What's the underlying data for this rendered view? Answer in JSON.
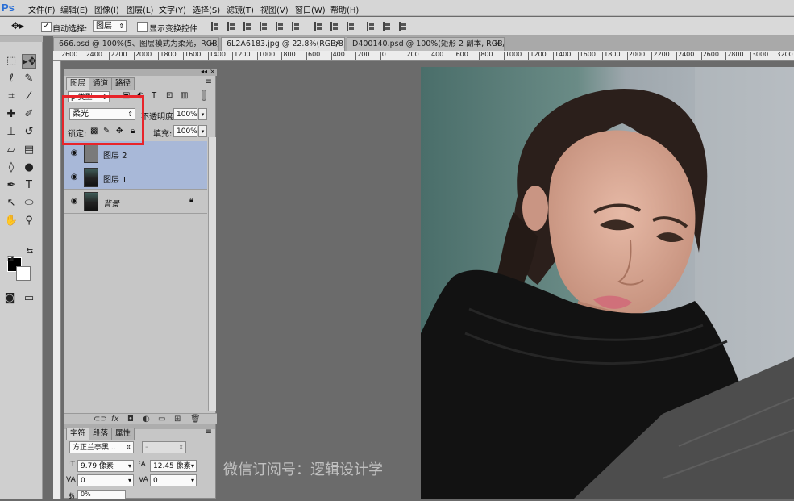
{
  "menubar": {
    "logo": "Ps",
    "items": [
      "文件(F)",
      "编辑(E)",
      "图像(I)",
      "图层(L)",
      "文字(Y)",
      "选择(S)",
      "滤镜(T)",
      "视图(V)",
      "窗口(W)",
      "帮助(H)"
    ]
  },
  "options": {
    "auto_select_label": "自动选择:",
    "auto_select_value": "图层",
    "show_transform_label": "显示变换控件"
  },
  "tabs": [
    {
      "label": "666.psd @ 100%(5、图层模式为柔光，RGB/8) *",
      "close": "×"
    },
    {
      "label": "6L2A6183.jpg @ 22.8%(RGB/8) *",
      "close": "×"
    },
    {
      "label": "D400140.psd @ 100%(矩形 2 副本, RGB/8)",
      "close": "×"
    }
  ],
  "ruler": {
    "ticks": [
      "2600",
      "2400",
      "2200",
      "2000",
      "1800",
      "1600",
      "1400",
      "1200",
      "1000",
      "800",
      "600",
      "400",
      "200",
      "0",
      "200",
      "400",
      "600",
      "800",
      "1000",
      "1200",
      "1400",
      "1600",
      "1800",
      "2000",
      "2200",
      "2400",
      "2600",
      "2800",
      "3000",
      "3200"
    ]
  },
  "layers_panel": {
    "tabs": [
      "图层",
      "通道",
      "路径"
    ],
    "kind_filter": "ρ 类型",
    "blend_mode": "柔光",
    "opacity_label": "不透明度:",
    "opacity_value": "100%",
    "lock_label": "锁定:",
    "fill_label": "填充:",
    "fill_value": "100%",
    "layers": [
      {
        "name": "图层 2",
        "selected": true
      },
      {
        "name": "图层 1",
        "selected": true
      },
      {
        "name": "背景",
        "selected": false
      }
    ]
  },
  "char_panel": {
    "tabs": [
      "字符",
      "段落",
      "属性"
    ],
    "font_family": "方正兰亭黑...",
    "font_style": "-",
    "font_size": "9.79 像素",
    "leading": "12.45 像素",
    "kerning": "0",
    "tracking": "0",
    "scale": "0%"
  },
  "watermark": "微信订阅号：逻辑设计学",
  "colors": {
    "highlight": "#e8242a",
    "selected_layer": "#a8b8d8"
  }
}
